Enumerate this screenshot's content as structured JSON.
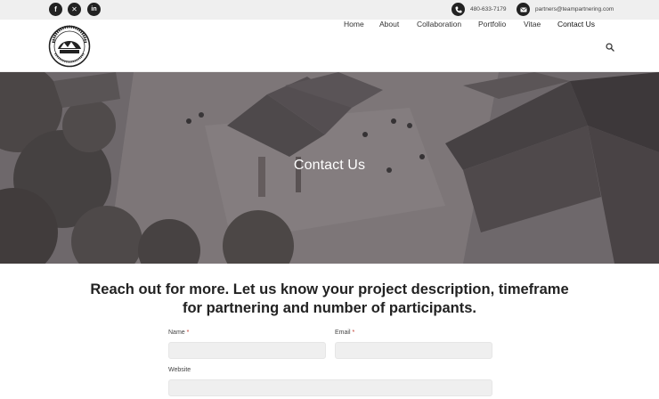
{
  "topbar": {
    "social": [
      {
        "name": "facebook",
        "glyph": "f"
      },
      {
        "name": "x",
        "glyph": "✕"
      },
      {
        "name": "linkedin",
        "glyph": "in"
      }
    ],
    "phone": "480-633-7179",
    "email": "partners@teampartnering.com"
  },
  "header": {
    "logo_text": "TEAM PARTNERING",
    "nav": [
      {
        "label": "Home",
        "active": false
      },
      {
        "label": "About",
        "active": false
      },
      {
        "label": "Collaboration",
        "active": false
      },
      {
        "label": "Portfolio",
        "active": false
      },
      {
        "label": "Vitae",
        "active": false
      },
      {
        "label": "Contact Us",
        "active": true
      }
    ]
  },
  "hero": {
    "title": "Contact Us"
  },
  "main": {
    "intro": "Reach out for more. Let us know your project description, timeframe for partnering and number of participants.",
    "form": {
      "name_label": "Name",
      "email_label": "Email",
      "website_label": "Website",
      "required_mark": "*",
      "name_value": "",
      "email_value": "",
      "website_value": ""
    }
  },
  "colors": {
    "topbar_bg": "#efefef",
    "icon_bg": "#222222",
    "field_bg": "#efefef",
    "required": "#c0392b"
  }
}
